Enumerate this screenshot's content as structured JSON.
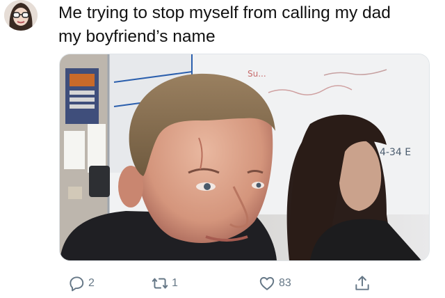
{
  "tweet": {
    "text_line1": "Me trying to stop myself from calling my dad",
    "text_line2": "my boyfriend’s name"
  },
  "media": {
    "whiteboard_text_1": "Su...",
    "whiteboard_text_2": "4-34 E",
    "poster_text": ""
  },
  "actions": {
    "reply_count": "2",
    "retweet_count": "1",
    "like_count": "83"
  },
  "colors": {
    "action_gray": "#657786",
    "text": "#111111"
  },
  "icons": [
    "reply-icon",
    "retweet-icon",
    "like-icon",
    "share-icon"
  ]
}
